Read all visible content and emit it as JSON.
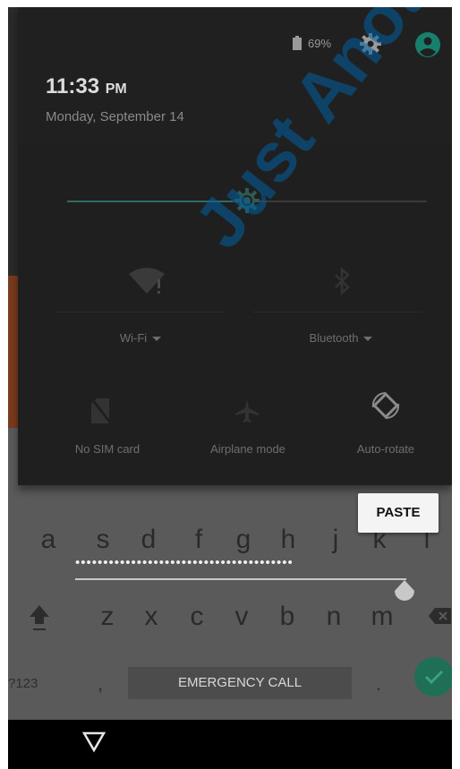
{
  "status_bar": {
    "battery_percent": "69%"
  },
  "header": {
    "time": "11:33",
    "ampm": "PM",
    "date": "Monday, September 14"
  },
  "brightness": {
    "level_fraction": 0.46
  },
  "tiles": {
    "wifi": "Wi-Fi",
    "bluetooth": "Bluetooth",
    "sim": "No SIM card",
    "airplane": "Airplane mode",
    "rotate": "Auto-rotate"
  },
  "popup": {
    "paste_label": "PASTE"
  },
  "password": {
    "masked": "•••••••••••••••••••••••••••••••••••••••"
  },
  "keyboard": {
    "row_middle": [
      "a",
      "s",
      "d",
      "f",
      "g",
      "h",
      "j",
      "k",
      "l"
    ],
    "row_bottom": [
      "z",
      "x",
      "c",
      "v",
      "b",
      "n",
      "m"
    ],
    "symbols_label": "?123",
    "comma": ",",
    "period": ".",
    "emergency_label": "EMERGENCY CALL"
  },
  "watermark": {
    "text": "Just Anoth"
  },
  "colors": {
    "accent": "#1f6f57",
    "brightness_fill": "#2f6b62",
    "watermark": "#005fa0"
  }
}
